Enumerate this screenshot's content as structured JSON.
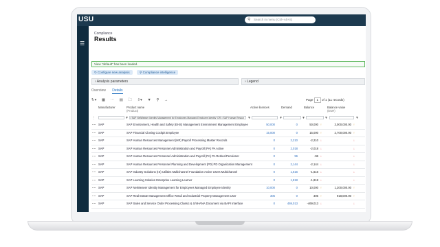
{
  "app": {
    "logo": "USU",
    "search_placeholder": "Search in menu (Ctrl+Alt+S)",
    "menu_icon": "menu-icon"
  },
  "header": {
    "breadcrumb": "Compliance",
    "title": "Results"
  },
  "banner": "View \"default\" has been loaded.",
  "actions": {
    "configure": "Configure new analysis",
    "intelligence": "Compliance intelligence"
  },
  "panels": {
    "analysis": "Analysis parameters",
    "legend": "Legend"
  },
  "tabs": [
    "Overview",
    "Details"
  ],
  "active_tab": "Details",
  "pager": {
    "label": "Page",
    "current": "1",
    "info": "of 1 (11 records)"
  },
  "columns": {
    "manufacturer": "Manufacturer",
    "product": "Product name",
    "product_sub": "(Product)",
    "active": "Active licences",
    "demand": "Demand",
    "balance": "Balance",
    "value": "Balance value",
    "value_sub": "(EUR)",
    "agg": "ANB"
  },
  "filter_product": "='SAP NetWeaver Identity Management for Employees Managed Employee Identity' OR ='SAP Human Resour",
  "rows": [
    {
      "manufacturer": "SAP",
      "product": "SAP Environment, Health and Safety (EHS) Management Environment Management Employee",
      "active": "50,000",
      "demand": "0",
      "balance": "50,000",
      "bdir": "up",
      "value": "3,000,000.00",
      "vdir": "up"
    },
    {
      "manufacturer": "SAP",
      "product": "SAP Financial Closing Cockpit Employee",
      "active": "15,000",
      "demand": "0",
      "balance": "15,000",
      "bdir": "up",
      "value": "2,700,000.00",
      "vdir": "up"
    },
    {
      "manufacturer": "SAP",
      "product": "SAP Human Resources Management (HR) Payroll Processing Master Records",
      "active": "0",
      "demand": "2,210",
      "balance": "-2,210",
      "bdir": "down",
      "value": "",
      "vdir": "down"
    },
    {
      "manufacturer": "SAP",
      "product": "SAP Human Resources Personnel Administration and Payroll (PA) PA Active",
      "active": "0",
      "demand": "2,018",
      "balance": "-2,018",
      "bdir": "down",
      "value": "",
      "vdir": "down"
    },
    {
      "manufacturer": "SAP",
      "product": "SAP Human Resources Personnel Administration and Payroll (PA) PA Retiree/Pensioner",
      "active": "0",
      "demand": "96",
      "balance": "-96",
      "bdir": "down",
      "value": "",
      "vdir": "down"
    },
    {
      "manufacturer": "SAP",
      "product": "SAP Human Resources Personnel Planning and Development (PD) PD Organization Management",
      "active": "0",
      "demand": "2,144",
      "balance": "-2,144",
      "bdir": "down",
      "value": "",
      "vdir": "down"
    },
    {
      "manufacturer": "SAP",
      "product": "SAP Industry Solutions (IS) Utilities Multichannel Foundation Active Users Multichannel",
      "active": "0",
      "demand": "1,616",
      "balance": "-1,616",
      "bdir": "down",
      "value": "",
      "vdir": "down"
    },
    {
      "manufacturer": "SAP",
      "product": "SAP Learning Solution Enterprise Learning Learner",
      "active": "0",
      "demand": "1,818",
      "balance": "-1,818",
      "bdir": "down",
      "value": "",
      "vdir": "down"
    },
    {
      "manufacturer": "SAP",
      "product": "SAP NetWeaver Identity Management for Employees Managed Employee Identity",
      "active": "10,000",
      "demand": "0",
      "balance": "10,000",
      "bdir": "up",
      "value": "1,200,000.00",
      "vdir": "up"
    },
    {
      "manufacturer": "SAP",
      "product": "SAP Real Estate Management Office Retail and Industrial Property Management User",
      "active": "305",
      "demand": "0",
      "balance": "305",
      "bdir": "up",
      "value": "918,000.00",
      "vdir": "up"
    },
    {
      "manufacturer": "SAP",
      "product": "SAP Sales and Service Order Processing Classic & S/4HANA Document via BAPI Interface",
      "active": "0",
      "demand": "469,013",
      "balance": "-469,013",
      "bdir": "down",
      "value": "",
      "vdir": "down"
    }
  ]
}
